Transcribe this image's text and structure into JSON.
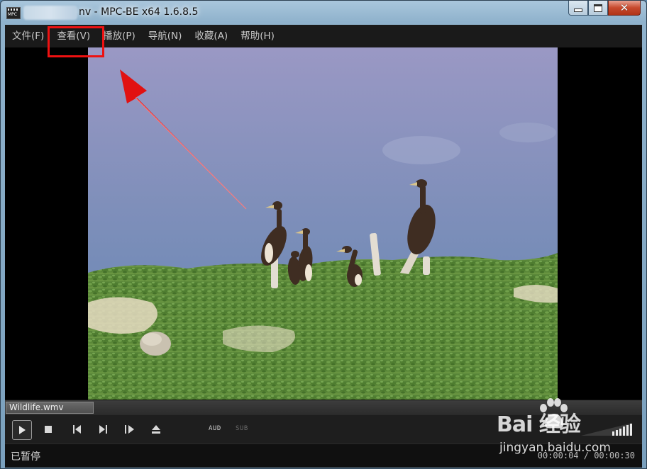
{
  "window": {
    "title": "nv - MPC-BE x64 1.6.8.5",
    "close_glyph": "✕"
  },
  "menu": [
    {
      "label": "文件(F)"
    },
    {
      "label": "查看(V)"
    },
    {
      "label": "播放(P)"
    },
    {
      "label": "导航(N)"
    },
    {
      "label": "收藏(A)"
    },
    {
      "label": "帮助(H)"
    }
  ],
  "seek": {
    "filename": "Wildlife.wmv"
  },
  "controls": {
    "aud_label": "AUD",
    "sub_label": "SUB"
  },
  "status": {
    "state": "已暂停",
    "time": "00:00:04 / 00:00:30"
  },
  "watermark": {
    "logo": "Bai  经验",
    "site": "jingyan.baidu.com"
  },
  "colors": {
    "annotation": "#e11111",
    "menu_bg": "#1a1a1a",
    "titlebar": "#a9c6dc"
  }
}
